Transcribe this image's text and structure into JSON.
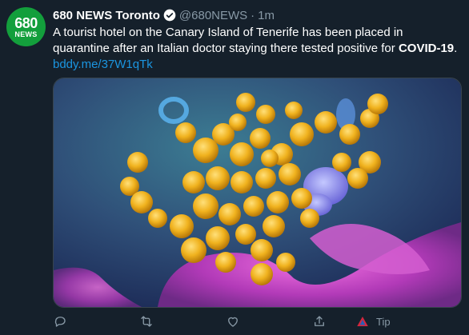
{
  "tweet": {
    "avatar": {
      "num": "680",
      "word": "NEWS"
    },
    "display_name": "680 NEWS Toronto",
    "handle": "@680NEWS",
    "separator": "·",
    "time": "1m",
    "text_part1": "A tourist hotel on the Canary Island of Tenerife has been placed in quarantine after an Italian doctor staying there tested positive for ",
    "text_bold": "COVID-19",
    "text_part2": ".",
    "link": "bddy.me/37W1qTk",
    "media": {
      "description": "microscope image of coronavirus particles"
    },
    "actions": {
      "reply": "reply-icon",
      "retweet": "retweet-icon",
      "like": "heart-icon",
      "share": "share-icon",
      "tip_label": "Tip"
    }
  },
  "colors": {
    "background": "#15202b",
    "muted": "#8899a6",
    "link": "#1b95e0",
    "avatar_green": "#139f3c"
  }
}
